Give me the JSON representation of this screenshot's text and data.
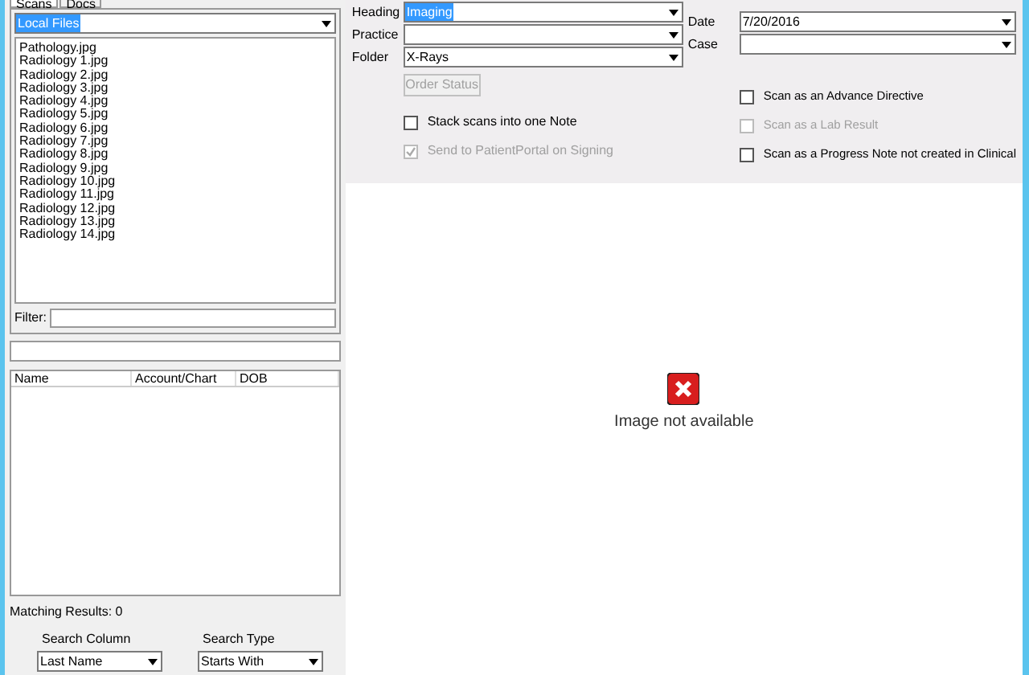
{
  "left_panel": {
    "tabs": [
      {
        "label": "Scans",
        "selected": true
      },
      {
        "label": "Docs",
        "selected": false
      }
    ],
    "source": {
      "value": "Local Files"
    },
    "files": [
      {
        "name": "Pathology.jpg"
      },
      {
        "name": "Radiology 1.jpg"
      },
      {
        "name": "Radiology 2.jpg"
      },
      {
        "name": "Radiology 3.jpg"
      },
      {
        "name": "Radiology 4.jpg"
      },
      {
        "name": "Radiology 5.jpg"
      },
      {
        "name": "Radiology 6.jpg"
      },
      {
        "name": "Radiology 7.jpg"
      },
      {
        "name": "Radiology 8.jpg"
      },
      {
        "name": "Radiology 9.jpg"
      },
      {
        "name": "Radiology 10.jpg"
      },
      {
        "name": "Radiology 11.jpg"
      },
      {
        "name": "Radiology 12.jpg"
      },
      {
        "name": "Radiology 13.jpg"
      },
      {
        "name": "Radiology 14.jpg"
      }
    ],
    "filter_label": "Filter:",
    "patients_table": {
      "columns": [
        "Name",
        "Account/Chart",
        "DOB"
      ]
    },
    "matching_results": "Matching Results: 0",
    "search_column": {
      "label": "Search Column",
      "value": "Last Name"
    },
    "search_type": {
      "label": "Search Type",
      "value": "Starts With"
    }
  },
  "form": {
    "left_fields": [
      {
        "label": "Heading",
        "value": "Imaging",
        "highlighted": true
      },
      {
        "label": "Practice"
      },
      {
        "label": "Folder",
        "value": "X-Rays"
      }
    ],
    "right_fields": [
      {
        "label": "Date",
        "value": "7/20/2016"
      },
      {
        "label": "Case"
      }
    ],
    "order_status_button": {
      "label": "Order Status",
      "disabled": true
    },
    "left_checkboxes": [
      {
        "label": "Stack scans into one Note",
        "checked": false,
        "disabled": false
      },
      {
        "label": "Send to PatientPortal on Signing",
        "checked": true,
        "disabled": true
      }
    ],
    "right_checkboxes": [
      {
        "label": "Scan as an Advance Directive",
        "checked": false,
        "disabled": false
      },
      {
        "label": "Scan as a Lab Result",
        "checked": false,
        "disabled": true
      },
      {
        "label": "Scan as a Progress Note not created in Clinical",
        "checked": false,
        "disabled": false
      }
    ]
  },
  "preview": {
    "message": "Image not available"
  }
}
